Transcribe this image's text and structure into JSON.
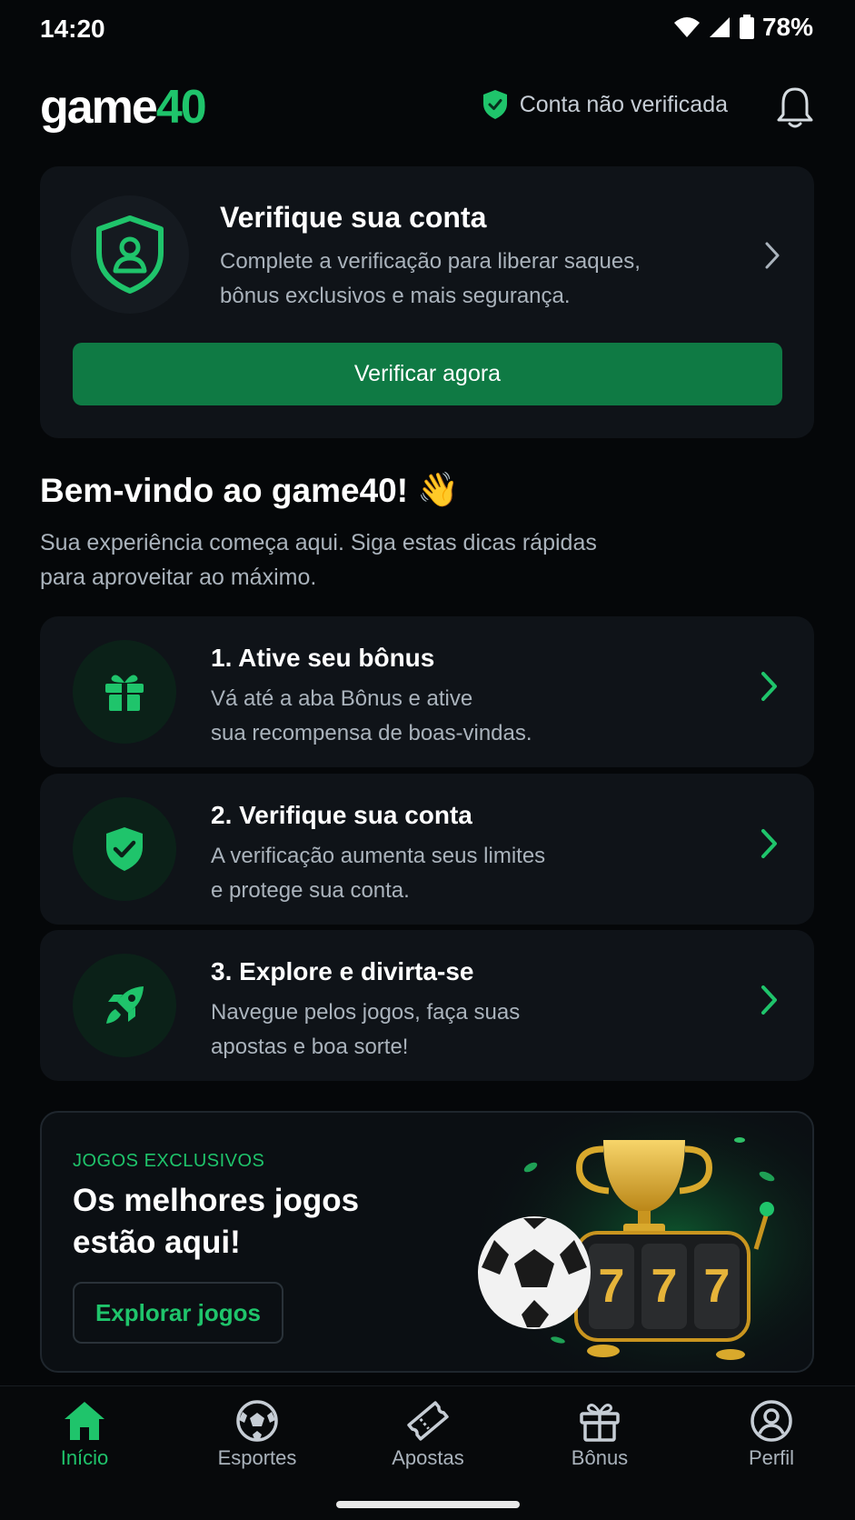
{
  "status_bar": {
    "time": "14:20",
    "battery": "78%"
  },
  "header": {
    "logo_text": "game",
    "logo_number": "40",
    "verification_status": "Conta não verificada"
  },
  "verify_card": {
    "title": "Verifique sua conta",
    "description": "Complete a verificação para liberar saques, bônus exclusivos e mais segurança.",
    "button_label": "Verificar agora"
  },
  "welcome": {
    "title": "Bem-vindo ao game40!",
    "emoji": "👋",
    "description": "Sua experiência começa aqui. Siga estas dicas rápidas para aproveitar ao máximo."
  },
  "steps": [
    {
      "title": "1. Ative seu bônus",
      "line1": "Vá até a aba Bônus e ative",
      "line2": "sua recompensa de boas-vindas.",
      "icon": "gift-icon"
    },
    {
      "title": "2. Verifique sua conta",
      "line1": "A verificação aumenta seus limites",
      "line2": "e protege sua conta.",
      "icon": "shield-check-icon"
    },
    {
      "title": "3. Explore e divirta-se",
      "line1": "Navegue pelos jogos, faça suas",
      "line2": "apostas e boa sorte!",
      "icon": "rocket-icon"
    }
  ],
  "promo": {
    "tag": "JOGOS EXCLUSIVOS",
    "title": "Os melhores jogos estão aqui!",
    "button_label": "Explorar jogos",
    "slot_digits": "777"
  },
  "bottom_nav": [
    {
      "label": "Início",
      "icon": "home-icon",
      "active": true
    },
    {
      "label": "Esportes",
      "icon": "soccer-ball-icon",
      "active": false
    },
    {
      "label": "Apostas",
      "icon": "ticket-icon",
      "active": false
    },
    {
      "label": "Bônus",
      "icon": "gift-icon",
      "active": false
    },
    {
      "label": "Perfil",
      "icon": "profile-icon",
      "active": false
    }
  ],
  "colors": {
    "accent": "#1fc46b",
    "button": "#0f7a44",
    "background": "#050709",
    "card": "#0f1318"
  }
}
